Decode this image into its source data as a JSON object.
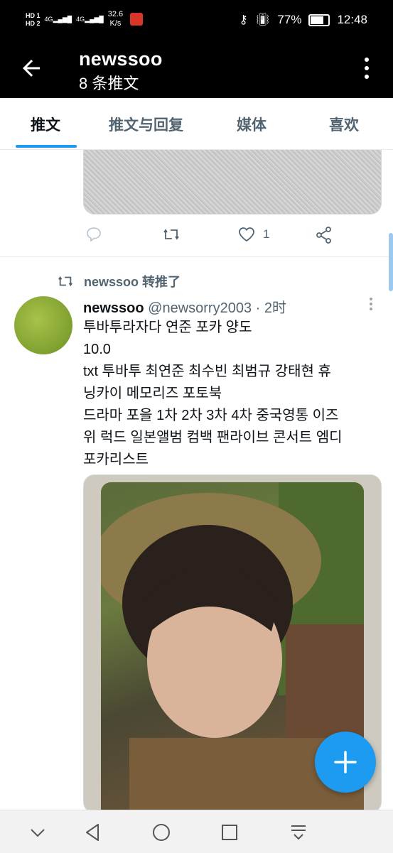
{
  "status_bar": {
    "network_speed": "32.6",
    "network_unit": "K/s",
    "battery": "77%",
    "time": "12:48",
    "sim1": "HD 1",
    "sim2": "HD 2",
    "signal1": "4G",
    "signal2": "4G"
  },
  "header": {
    "title": "newssoo",
    "subtitle": "8 条推文"
  },
  "tabs": [
    {
      "label": "推文"
    },
    {
      "label": "推文与回复"
    },
    {
      "label": "媒体"
    },
    {
      "label": "喜欢"
    }
  ],
  "previous_tweet": {
    "like_count": "1"
  },
  "retweet": {
    "label": "newssoo 转推了"
  },
  "tweet": {
    "name": "newssoo",
    "handle": "@newsorry2003",
    "separator": "·",
    "time": "2时",
    "lines": [
      "투바투라자다 연준 포카 양도",
      "10.0",
      "txt 투바투 최연준 최수빈 최범규 강태현 휴",
      "닝카이 메모리즈 포토북",
      "드라마 포을 1차 2차 3차 4차 중국영통 이즈",
      "위 럭드 일본앨범 컴백 팬라이브 콘서트 엠디",
      "포카리스트"
    ]
  },
  "colors": {
    "accent": "#1d9bf0",
    "secondary_text": "#536471",
    "primary_text": "#0f1419"
  }
}
